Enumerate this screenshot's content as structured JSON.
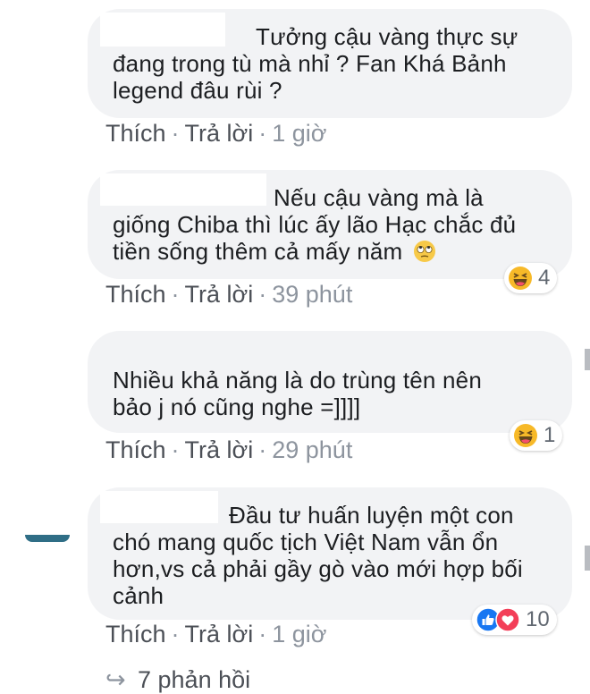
{
  "comments": [
    {
      "text_lines": [
        "Tưởng cậu vàng thực sự",
        "đang trong tù mà nhỉ ? Fan Khá Bảnh",
        "legend đâu rùi ?"
      ],
      "actions": {
        "like": "Thích",
        "reply": "Trả lời",
        "time": "1 giờ"
      }
    },
    {
      "text_lines": [
        "Nếu cậu vàng mà là",
        "giống Chiba thì lúc ấy lão Hạc chắc đủ",
        "tiền sống thêm cả mấy năm"
      ],
      "actions": {
        "like": "Thích",
        "reply": "Trả lời",
        "time": "39 phút"
      },
      "reactions": {
        "count": "4",
        "icons": [
          "haha-icon"
        ]
      }
    },
    {
      "text_lines": [
        "Nhiều khả năng là do trùng tên nên",
        "bảo j nó cũng nghe =]]]]"
      ],
      "actions": {
        "like": "Thích",
        "reply": "Trả lời",
        "time": "29 phút"
      },
      "reactions": {
        "count": "1",
        "icons": [
          "haha-icon"
        ]
      }
    },
    {
      "text_lines": [
        "Đầu tư huấn luyện một con",
        "chó mang quốc tịch Việt Nam vẫn ổn",
        "hơn,vs cả phải gầy gò vào mới hợp bối",
        "cảnh"
      ],
      "actions": {
        "like": "Thích",
        "reply": "Trả lời",
        "time": "1 giờ"
      },
      "reactions": {
        "count": "10",
        "icons": [
          "like-icon",
          "love-icon"
        ]
      }
    }
  ],
  "view_replies": "7 phản hồi",
  "colors": {
    "bubble": "#f2f3f5",
    "action": "#4b4f56",
    "meta": "#8d949e",
    "like_blue": "#1877f2",
    "love_red": "#f33e58",
    "haha_yellow": "#f7b928"
  }
}
